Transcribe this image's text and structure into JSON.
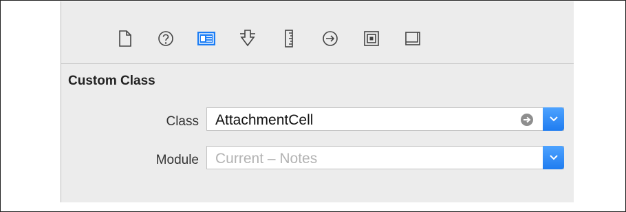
{
  "toolbar": {
    "icons": [
      {
        "name": "file-icon",
        "selected": false
      },
      {
        "name": "help-icon",
        "selected": false
      },
      {
        "name": "identity-inspector-icon",
        "selected": true
      },
      {
        "name": "attributes-icon",
        "selected": false
      },
      {
        "name": "size-ruler-icon",
        "selected": false
      },
      {
        "name": "connections-icon",
        "selected": false
      },
      {
        "name": "bindings-icon",
        "selected": false
      },
      {
        "name": "effects-icon",
        "selected": false
      }
    ],
    "accent": "#1a7cf5"
  },
  "custom_class": {
    "section_title": "Custom Class",
    "class_label": "Class",
    "class_value": "AttachmentCell",
    "module_label": "Module",
    "module_placeholder": "Current – Notes"
  }
}
